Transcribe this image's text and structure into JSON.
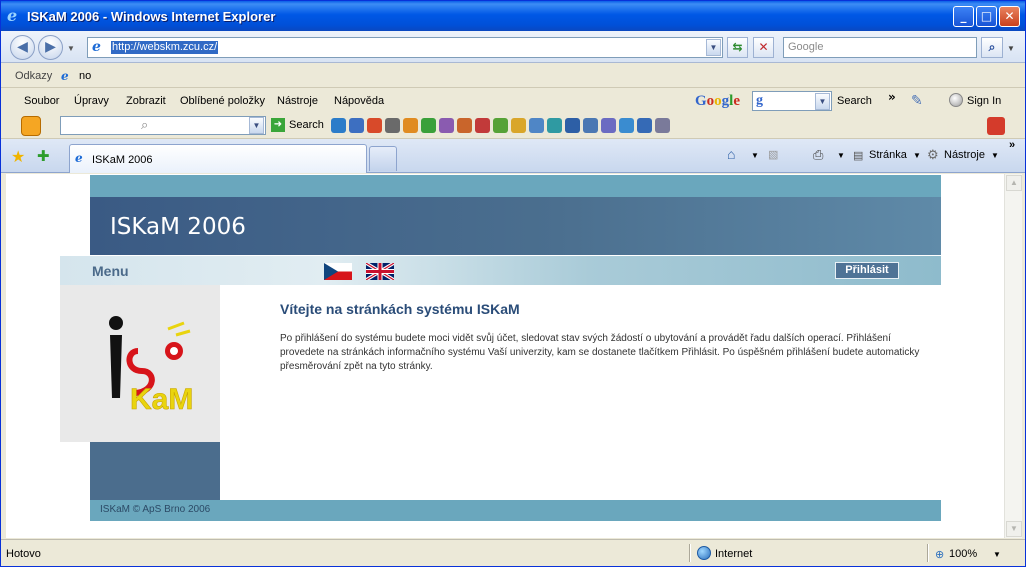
{
  "window": {
    "title": "ISKaM 2006 - Windows Internet Explorer",
    "minimize": "_",
    "maximize": "□",
    "close": "✕"
  },
  "address": {
    "url": "http://webskm.zcu.cz/",
    "search_placeholder": "Google"
  },
  "links_bar": {
    "label": "Odkazy",
    "link": "no"
  },
  "menu": {
    "items": [
      "Soubor",
      "Úpravy",
      "Zobrazit",
      "Oblíbené položky",
      "Nástroje",
      "Nápověda"
    ],
    "google_logo": "Google",
    "google_select": "g",
    "search_label": "Search",
    "more": "»",
    "sign_in": "Sign In"
  },
  "toolbar2": {
    "search_label": "Search"
  },
  "tabs": {
    "active_tab": "ISKaM 2006",
    "page_menu": "Stránka",
    "tools_menu": "Nástroje"
  },
  "page": {
    "site_title": "ISKaM 2006",
    "menu_label": "Menu",
    "login_button": "Přihlásit",
    "welcome_heading": "Vítejte na stránkách systému ISKaM",
    "welcome_text": "Po přihlášení do systému budete moci vidět svůj účet, sledovat stav svých žádostí o ubytování a provádět řadu dalších operací. Přihlášení provedete na stránkách informačního systému Vaší univerzity, kam se dostanete tlačítkem Přihlásit. Po úspěšném přihlášení budete automaticky přesměrování zpět na tyto stránky.",
    "logo_top": "iS",
    "logo_bottom": "KaM",
    "footer": "ISKaM © ApS Brno 2006"
  },
  "status": {
    "text": "Hotovo",
    "zone": "Internet",
    "zoom": "100%"
  },
  "colors": {
    "header_bg": "#3a5a84",
    "accent_strip": "#6aa7bd",
    "heading": "#2a4c78",
    "login_btn": "#4f7396"
  }
}
